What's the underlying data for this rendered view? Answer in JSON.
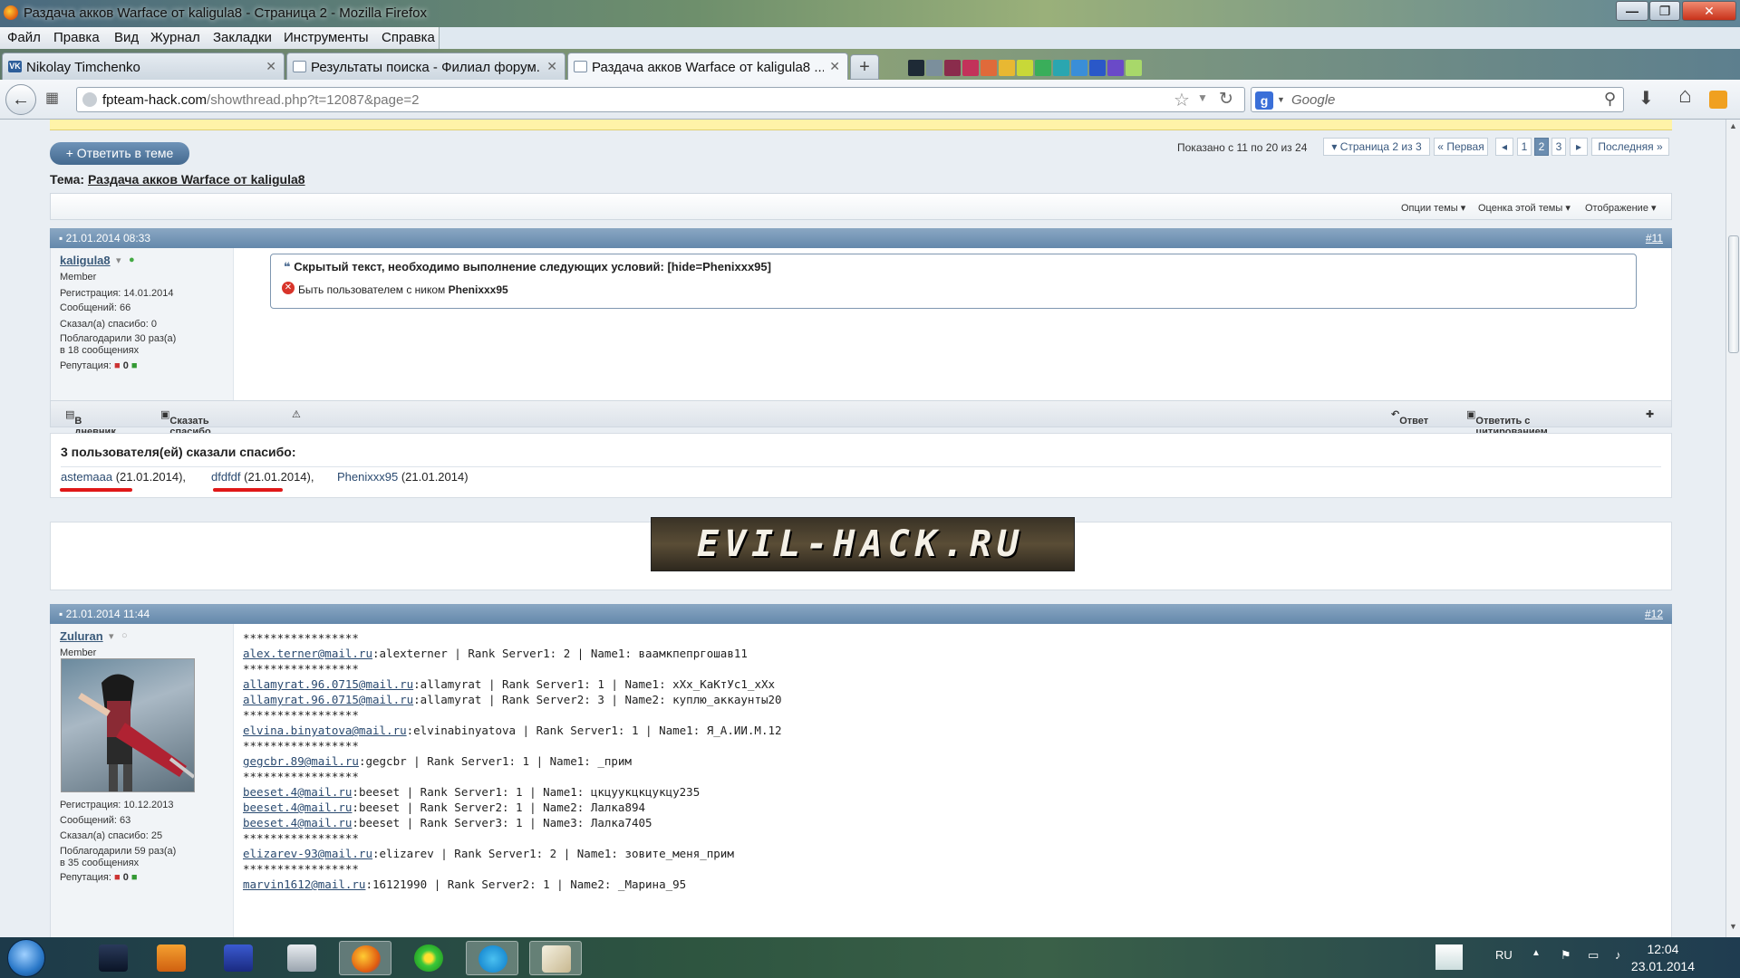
{
  "window": {
    "title": "Раздача акков Warface от kaligula8 - Страница 2 - Mozilla Firefox",
    "min_symbol": "—",
    "max_symbol": "❐",
    "close_symbol": "✕"
  },
  "menu": [
    "Файл",
    "Правка",
    "Вид",
    "Журнал",
    "Закладки",
    "Инструменты",
    "Справка"
  ],
  "tabs": [
    {
      "label": "Nikolay Timchenko",
      "favicon": "vk-icon",
      "favicon_text": "VK"
    },
    {
      "label": "Результаты поиска - Филиал форум...",
      "favicon": "page-icon",
      "favicon_text": ""
    },
    {
      "label": "Раздача акков Warface от kaligula8 ...",
      "favicon": "page-icon",
      "favicon_text": ""
    }
  ],
  "newtab_label": "+",
  "tab_close": "✕",
  "swatches": [
    "#1e2a36",
    "#7b8f9c",
    "#8a2c4c",
    "#c2325a",
    "#e06a3a",
    "#e8b832",
    "#c8d838",
    "#3aae5a",
    "#2aa6b0",
    "#3a8ed8",
    "#2a58c8",
    "#6a4ac8",
    "#a8d86a"
  ],
  "nav": {
    "back": "←",
    "url_host": "fpteam-hack.com",
    "url_path": "/showthread.php?t=12087&page=2",
    "search_placeholder": "Google",
    "search_engine_letter": "g",
    "star": "☆",
    "reload": "↻",
    "search_glyph": "⚲",
    "download": "⬇",
    "home": "⌂"
  },
  "thread": {
    "reply_button": "+ Ответить в теме",
    "shown": "Показано с 11 по 20 из 24",
    "page_of": "Страница 2 из 3",
    "first": "Первая",
    "prev": "◂",
    "pages": [
      "1",
      "2",
      "3"
    ],
    "current_page": "2",
    "next": "▸",
    "last": "Последняя",
    "title_prefix": "Тема:",
    "title": "Раздача акков Warface от kaligula8",
    "tools": [
      "Опции темы",
      "Оценка этой темы",
      "Отображение"
    ]
  },
  "post11": {
    "date": "21.01.2014 08:33",
    "num": "#11",
    "user": "kaligula8",
    "rank": "Member",
    "reg": "Регистрация:   14.01.2014",
    "msgs": "Сообщений:   66",
    "said_thanks": "Сказал(а) спасибо:   0",
    "thanked": "Поблагодарили 30 раз(а)",
    "thanked_in": "в 18 сообщениях",
    "rep_label": "Репутация:",
    "rep_value": "0",
    "hide_title": "Скрытый текст, необходимо выполнение следующих условий: [hide=Phenixxx95]",
    "hide_cond": "Быть пользователем с ником",
    "hide_nick": "Phenixxx95",
    "foot": {
      "diary": "В дневник",
      "thanks": "Сказать спасибо",
      "warn": "⚠",
      "reply": "Ответ",
      "quote": "Ответить с цитированием"
    }
  },
  "thanks": {
    "title": "3 пользователя(ей) сказали спасибо:",
    "users": [
      {
        "name": "astemaaa",
        "date": " (21.01.2014),"
      },
      {
        "name": "dfdfdf",
        "date": " (21.01.2014),"
      },
      {
        "name": "Phenixxx95",
        "date": " (21.01.2014)"
      }
    ]
  },
  "banner_text": "EVIL-HACK.RU",
  "post12": {
    "date": "21.01.2014 11:44",
    "num": "#12",
    "user": "Zuluran",
    "rank": "Member",
    "reg": "Регистрация:   10.12.2013",
    "msgs": "Сообщений:   63",
    "said_thanks": "Сказал(а) спасибо:   25",
    "thanked": "Поблагодарили 59 раз(а)",
    "thanked_in": "в 35 сообщениях",
    "rep_label": "Репутация:",
    "rep_value": "0",
    "lines": [
      {
        "link": "",
        "rest": "*****************"
      },
      {
        "link": "alex.terner@mail.ru",
        "rest": ":alexterner | Rank Server1: 2 | Name1: ваамкпепргошав11"
      },
      {
        "link": "",
        "rest": "*****************"
      },
      {
        "link": "allamyrat.96.0715@mail.ru",
        "rest": ":allamyrat | Rank Server1: 1 | Name1: xXx_КаКтУс1_xXx"
      },
      {
        "link": "allamyrat.96.0715@mail.ru",
        "rest": ":allamyrat | Rank Server2: 3 | Name2: куплю_аккаунты20"
      },
      {
        "link": "",
        "rest": "*****************"
      },
      {
        "link": "elvina.binyatova@mail.ru",
        "rest": ":elvinabinyatova | Rank Server1: 1 | Name1: Я_А.ИИ.М.12"
      },
      {
        "link": "",
        "rest": "*****************"
      },
      {
        "link": "gegcbr.89@mail.ru",
        "rest": ":gegcbr | Rank Server1: 1 | Name1: _прим"
      },
      {
        "link": "",
        "rest": "*****************"
      },
      {
        "link": "beeset.4@mail.ru",
        "rest": ":beeset | Rank Server1: 1 | Name1: цкцуукцкцукцу235"
      },
      {
        "link": "beeset.4@mail.ru",
        "rest": ":beeset | Rank Server2: 1 | Name2: Лалка894"
      },
      {
        "link": "beeset.4@mail.ru",
        "rest": ":beeset | Rank Server3: 1 | Name3: Лалка7405"
      },
      {
        "link": "",
        "rest": "*****************"
      },
      {
        "link": "elizarev-93@mail.ru",
        "rest": ":elizarev | Rank Server1: 2 | Name1: зовите_меня_прим"
      },
      {
        "link": "",
        "rest": "*****************"
      },
      {
        "link": "marvin1612@mail.ru",
        "rest": ":16121990 | Rank Server2: 1 | Name2: _Марина_95"
      }
    ]
  },
  "taskbar": {
    "lang": "RU",
    "time": "12:04",
    "date": "23.01.2014"
  }
}
